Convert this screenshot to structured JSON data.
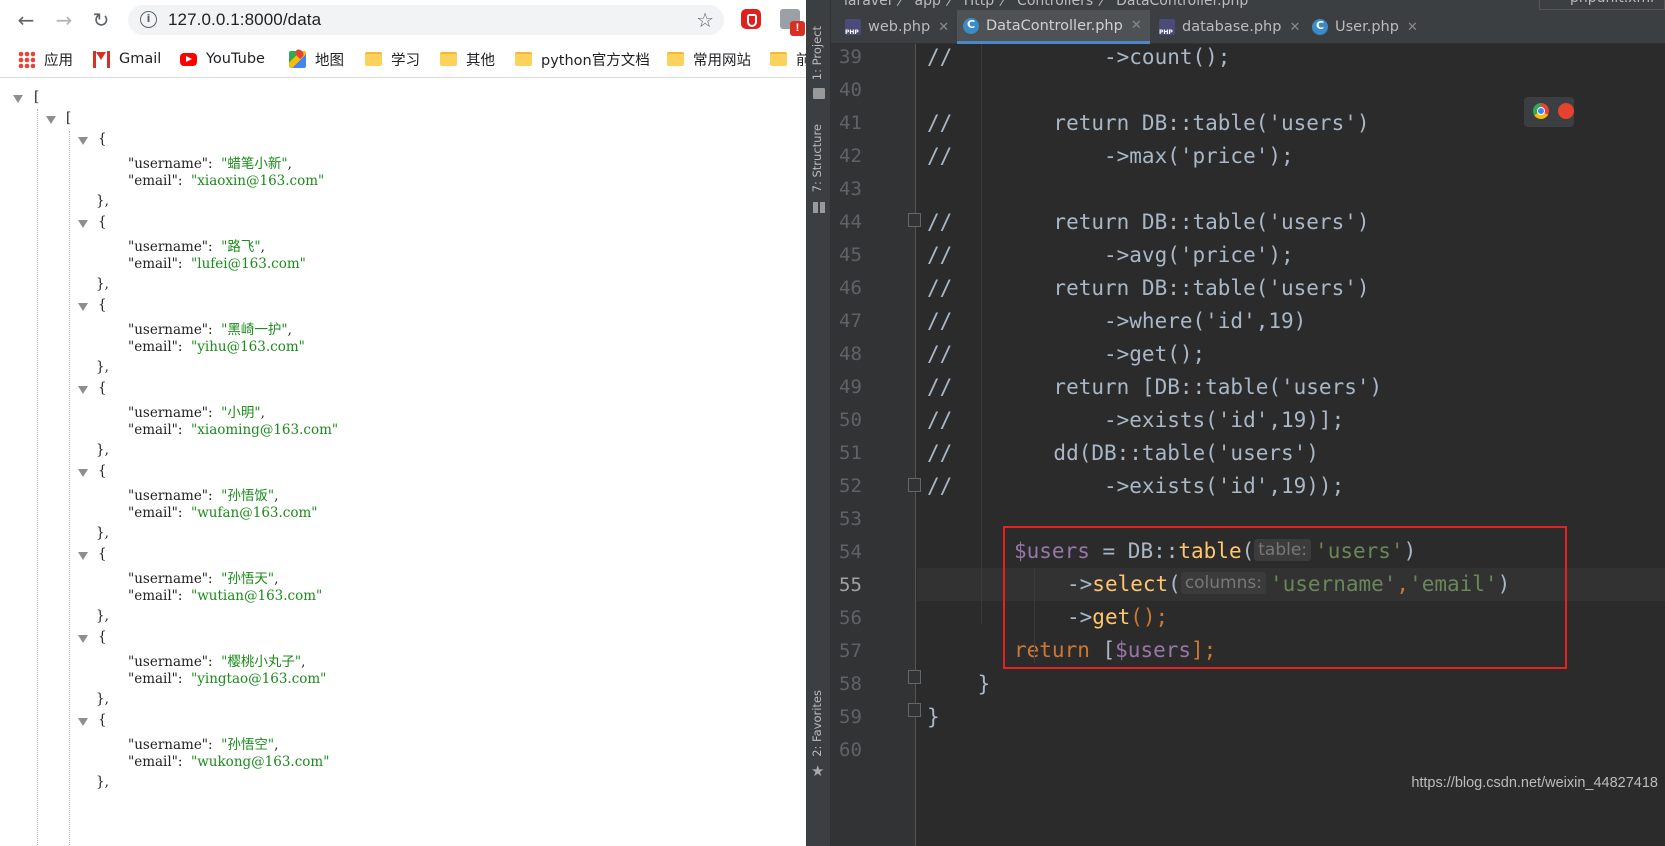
{
  "browser": {
    "url": "127.0.0.1:8000/data",
    "bookmarks": [
      {
        "label": "应用",
        "icon": "apps-icon"
      },
      {
        "label": "Gmail",
        "icon": "gmail-icon"
      },
      {
        "label": "YouTube",
        "icon": "youtube-icon"
      },
      {
        "label": "地图",
        "icon": "maps-icon"
      },
      {
        "label": "学习",
        "icon": "folder-icon"
      },
      {
        "label": "其他",
        "icon": "folder-icon"
      },
      {
        "label": "python官方文档",
        "icon": "folder-icon"
      },
      {
        "label": "常用网站",
        "icon": "folder-icon"
      },
      {
        "label": "前",
        "icon": "folder-icon"
      }
    ],
    "json_users": [
      {
        "username": "蜡笔小新",
        "email": "xiaoxin@163.com"
      },
      {
        "username": "路飞",
        "email": "lufei@163.com"
      },
      {
        "username": "黑崎一护",
        "email": "yihu@163.com"
      },
      {
        "username": "小明",
        "email": "xiaoming@163.com"
      },
      {
        "username": "孙悟饭",
        "email": "wufan@163.com"
      },
      {
        "username": "孙悟天",
        "email": "wutian@163.com"
      },
      {
        "username": "樱桃小丸子",
        "email": "yingtao@163.com"
      },
      {
        "username": "孙悟空",
        "email": "wukong@163.com"
      }
    ]
  },
  "ide": {
    "breadcrumb": "laravel 〉 app 〉 Http 〉 Controllers 〉 DataController.php",
    "phpunit_tab": "phpunit.xml",
    "side_tools": {
      "project": "1: Project",
      "structure": "7: Structure",
      "favorites": "2: Favorites"
    },
    "tabs": [
      {
        "label": "web.php",
        "icon": "php-file-icon",
        "active": false
      },
      {
        "label": "DataController.php",
        "icon": "class-icon",
        "active": true
      },
      {
        "label": "database.php",
        "icon": "php-file-icon",
        "active": false
      },
      {
        "label": "User.php",
        "icon": "class-icon",
        "active": false
      }
    ],
    "current_line": 55,
    "lines": [
      {
        "n": "39",
        "text": "//            ->count();"
      },
      {
        "n": "40",
        "text": ""
      },
      {
        "n": "41",
        "text": "//        return DB::table('users')"
      },
      {
        "n": "42",
        "text": "//            ->max('price');"
      },
      {
        "n": "43",
        "text": ""
      },
      {
        "n": "44",
        "text": "//        return DB::table('users')"
      },
      {
        "n": "45",
        "text": "//            ->avg('price');"
      },
      {
        "n": "46",
        "text": "//        return DB::table('users')"
      },
      {
        "n": "47",
        "text": "//            ->where('id',19)"
      },
      {
        "n": "48",
        "text": "//            ->get();"
      },
      {
        "n": "49",
        "text": "//        return [DB::table('users')"
      },
      {
        "n": "50",
        "text": "//            ->exists('id',19)];"
      },
      {
        "n": "51",
        "text": "//        dd(DB::table('users')"
      },
      {
        "n": "52",
        "text": "//            ->exists('id',19));"
      },
      {
        "n": "53",
        "text": ""
      },
      {
        "n": "54",
        "text": ""
      },
      {
        "n": "55",
        "text": ""
      },
      {
        "n": "56",
        "text": ""
      },
      {
        "n": "57",
        "text": ""
      },
      {
        "n": "58",
        "text": "    }"
      },
      {
        "n": "59",
        "text": "}"
      },
      {
        "n": "60",
        "text": ""
      }
    ],
    "code54": {
      "var": "$users",
      "op": " = ",
      "cls": "DB::",
      "fn": "table",
      "open": "(",
      "hint": "table:",
      "arg": "'users'",
      "close": ")"
    },
    "code55": {
      "arrow": "->",
      "fn": "select",
      "open": "(",
      "hint": "columns:",
      "arg1": "'username'",
      "comma": ",",
      "arg2": "'email'",
      "close": ")"
    },
    "code56": {
      "arrow": "->",
      "fn": "get",
      "rest": "();"
    },
    "code57": {
      "kw": "return",
      "open": " [",
      "var": "$users",
      "close": "];"
    },
    "watermark": "https://blog.csdn.net/weixin_44827418",
    "accent": "#e52222"
  }
}
